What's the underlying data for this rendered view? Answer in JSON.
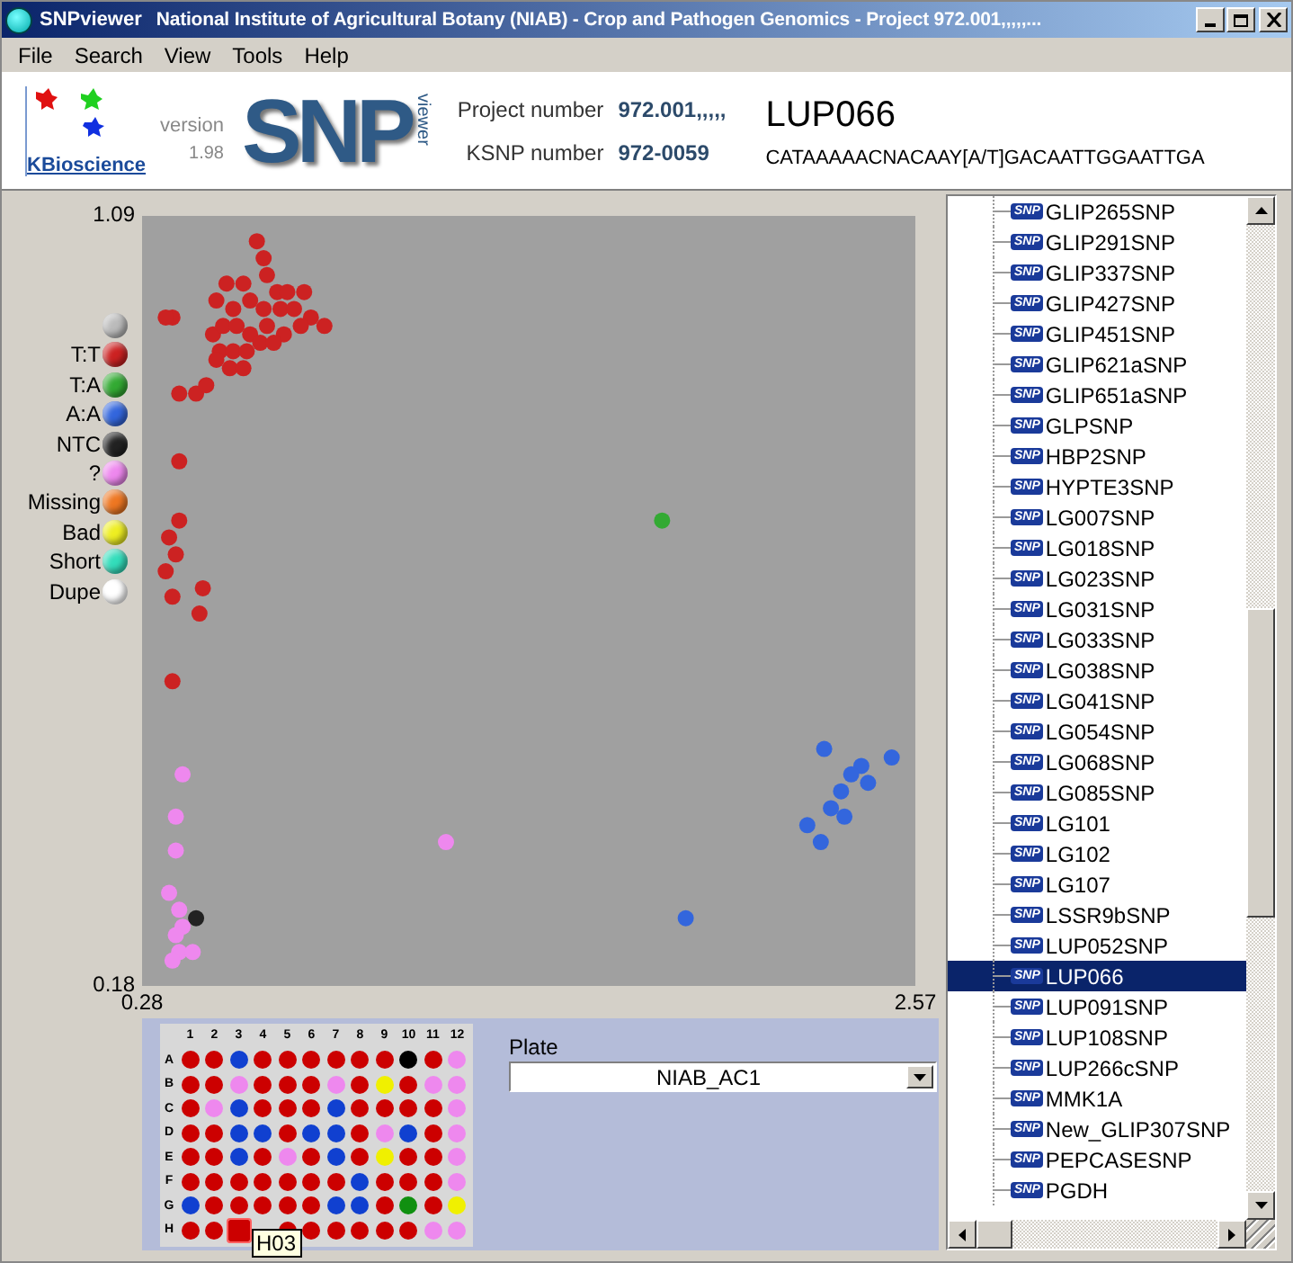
{
  "window": {
    "app_name": "SNPviewer",
    "title": "National Institute of Agricultural Botany (NIAB) - Crop and Pathogen Genomics - Project 972.001,,,,,..."
  },
  "menu": [
    "File",
    "Search",
    "View",
    "Tools",
    "Help"
  ],
  "header": {
    "company": "KBioscience",
    "version_label": "version",
    "version": "1.98",
    "logo_text": "SNP",
    "logo_subtext": "viewer",
    "project_label": "Project number",
    "project_value": "972.001,,,,,",
    "ksnp_label": "KSNP number",
    "ksnp_value": "972-0059",
    "snp_name": "LUP066",
    "sequence": "CATAAAAACNACAAY[A/T]GACAATTGGAATTGA"
  },
  "legend_top": [
    {
      "color": "#bbbbbb"
    }
  ],
  "legend_bottom": [
    {
      "label": "Missing",
      "color": "#ee7722"
    },
    {
      "label": "Bad",
      "color": "#eeee22"
    },
    {
      "label": "Short",
      "color": "#33ddbb"
    },
    {
      "label": "Dupe",
      "color": "#ffffff"
    }
  ],
  "plot": {
    "chart_data": {
      "type": "scatter",
      "xlim": [
        0.28,
        2.57
      ],
      "ylim": [
        0.18,
        1.09
      ],
      "xticks": [
        0.28,
        2.57
      ],
      "yticks": [
        0.18,
        1.09
      ],
      "series": [
        {
          "name": "T:T",
          "color": "#cc2222",
          "x": [
            0.62,
            0.64,
            0.65,
            0.58,
            0.53,
            0.68,
            0.71,
            0.76,
            0.5,
            0.55,
            0.6,
            0.64,
            0.69,
            0.73,
            0.78,
            0.82,
            0.37,
            0.35,
            0.49,
            0.52,
            0.56,
            0.6,
            0.65,
            0.7,
            0.75,
            0.51,
            0.55,
            0.59,
            0.63,
            0.67,
            0.54,
            0.58,
            0.5,
            0.39,
            0.44,
            0.47,
            0.39,
            0.39,
            0.36,
            0.38,
            0.35,
            0.37,
            0.46,
            0.45,
            0.37
          ],
          "values": [
            1.06,
            1.04,
            1.02,
            1.01,
            1.01,
            1.0,
            1.0,
            1.0,
            0.99,
            0.98,
            0.99,
            0.98,
            0.98,
            0.98,
            0.97,
            0.96,
            0.97,
            0.97,
            0.95,
            0.96,
            0.96,
            0.95,
            0.96,
            0.95,
            0.96,
            0.93,
            0.93,
            0.93,
            0.94,
            0.94,
            0.91,
            0.91,
            0.92,
            0.88,
            0.88,
            0.89,
            0.8,
            0.73,
            0.71,
            0.69,
            0.67,
            0.64,
            0.65,
            0.62,
            0.54
          ]
        },
        {
          "name": "T:A",
          "color": "#33aa33",
          "x": [
            1.82
          ],
          "values": [
            0.73
          ]
        },
        {
          "name": "A:A",
          "color": "#3366dd",
          "x": [
            2.3,
            2.5,
            2.41,
            2.38,
            2.43,
            2.35,
            2.32,
            2.36,
            2.25,
            2.29,
            1.89
          ],
          "values": [
            0.46,
            0.45,
            0.44,
            0.43,
            0.42,
            0.41,
            0.39,
            0.38,
            0.37,
            0.35,
            0.26
          ]
        },
        {
          "name": "NTC",
          "color": "#222222",
          "x": [
            0.44
          ],
          "values": [
            0.26
          ]
        },
        {
          "name": "?",
          "color": "#ee88ee",
          "x": [
            0.4,
            0.38,
            0.38,
            1.18,
            0.36,
            0.39,
            0.4,
            0.38,
            0.39,
            0.43,
            0.37
          ],
          "values": [
            0.43,
            0.38,
            0.34,
            0.35,
            0.29,
            0.27,
            0.25,
            0.24,
            0.22,
            0.22,
            0.21
          ]
        }
      ]
    }
  },
  "plate": {
    "columns": [
      "1",
      "2",
      "3",
      "4",
      "5",
      "6",
      "7",
      "8",
      "9",
      "10",
      "11",
      "12"
    ],
    "rows": [
      {
        "label": "A",
        "wells": [
          {
            "color": "#cc0000"
          },
          {
            "color": "#cc0000"
          },
          {
            "color": "#1040d0"
          },
          {
            "color": "#cc0000"
          },
          {
            "color": "#cc0000"
          },
          {
            "color": "#cc0000"
          },
          {
            "color": "#cc0000"
          },
          {
            "color": "#cc0000"
          },
          {
            "color": "#cc0000"
          },
          {
            "color": "#000000"
          },
          {
            "color": "#cc0000"
          },
          {
            "color": "#ee88ee"
          }
        ]
      },
      {
        "label": "B",
        "wells": [
          {
            "color": "#cc0000"
          },
          {
            "color": "#cc0000"
          },
          {
            "color": "#ee88ee"
          },
          {
            "color": "#cc0000"
          },
          {
            "color": "#cc0000"
          },
          {
            "color": "#cc0000"
          },
          {
            "color": "#ee88ee"
          },
          {
            "color": "#cc0000"
          },
          {
            "color": "#f0f000"
          },
          {
            "color": "#cc0000"
          },
          {
            "color": "#ee88ee"
          },
          {
            "color": "#ee88ee"
          }
        ]
      },
      {
        "label": "C",
        "wells": [
          {
            "color": "#cc0000"
          },
          {
            "color": "#ee88ee"
          },
          {
            "color": "#1040d0"
          },
          {
            "color": "#cc0000"
          },
          {
            "color": "#cc0000"
          },
          {
            "color": "#cc0000"
          },
          {
            "color": "#1040d0"
          },
          {
            "color": "#cc0000"
          },
          {
            "color": "#cc0000"
          },
          {
            "color": "#cc0000"
          },
          {
            "color": "#cc0000"
          },
          {
            "color": "#ee88ee"
          }
        ]
      },
      {
        "label": "D",
        "wells": [
          {
            "color": "#cc0000"
          },
          {
            "color": "#cc0000"
          },
          {
            "color": "#1040d0"
          },
          {
            "color": "#1040d0"
          },
          {
            "color": "#cc0000"
          },
          {
            "color": "#1040d0"
          },
          {
            "color": "#1040d0"
          },
          {
            "color": "#cc0000"
          },
          {
            "color": "#ee88ee"
          },
          {
            "color": "#1040d0"
          },
          {
            "color": "#cc0000"
          },
          {
            "color": "#ee88ee"
          }
        ]
      },
      {
        "label": "E",
        "wells": [
          {
            "color": "#cc0000"
          },
          {
            "color": "#cc0000"
          },
          {
            "color": "#1040d0"
          },
          {
            "color": "#cc0000"
          },
          {
            "color": "#ee88ee"
          },
          {
            "color": "#cc0000"
          },
          {
            "color": "#1040d0"
          },
          {
            "color": "#cc0000"
          },
          {
            "color": "#f0f000"
          },
          {
            "color": "#cc0000"
          },
          {
            "color": "#cc0000"
          },
          {
            "color": "#ee88ee"
          }
        ]
      },
      {
        "label": "F",
        "wells": [
          {
            "color": "#cc0000"
          },
          {
            "color": "#cc0000"
          },
          {
            "color": "#cc0000"
          },
          {
            "color": "#cc0000"
          },
          {
            "color": "#cc0000"
          },
          {
            "color": "#cc0000"
          },
          {
            "color": "#cc0000"
          },
          {
            "color": "#1040d0"
          },
          {
            "color": "#cc0000"
          },
          {
            "color": "#cc0000"
          },
          {
            "color": "#cc0000"
          },
          {
            "color": "#ee88ee"
          }
        ]
      },
      {
        "label": "G",
        "wells": [
          {
            "color": "#1040d0"
          },
          {
            "color": "#cc0000"
          },
          {
            "color": "#cc0000"
          },
          {
            "color": "#cc0000"
          },
          {
            "color": "#cc0000"
          },
          {
            "color": "#cc0000"
          },
          {
            "color": "#1040d0"
          },
          {
            "color": "#1040d0"
          },
          {
            "color": "#cc0000"
          },
          {
            "color": "#109010"
          },
          {
            "color": "#cc0000"
          },
          {
            "color": "#f0f000"
          }
        ]
      },
      {
        "label": "H",
        "wells": [
          {
            "color": "#cc0000",
            "selected": false
          },
          {
            "color": "#cc0000",
            "selected": false
          },
          {
            "color": "#cc0000",
            "selected": true
          },
          {
            "color": "#cc0000",
            "selected": false
          },
          {
            "color": "#cc0000",
            "selected": false
          },
          {
            "color": "#cc0000",
            "selected": false
          },
          {
            "color": "#cc0000",
            "selected": false
          },
          {
            "color": "#cc0000",
            "selected": false
          },
          {
            "color": "#cc0000",
            "selected": false
          },
          {
            "color": "#ee88ee",
            "selected": false
          },
          {
            "color": "#ee88ee",
            "selected": false
          }
        ]
      }
    ],
    "tooltip": "H03",
    "plate_label": "Plate",
    "plate_value": "NIAB_AC1"
  },
  "tree": {
    "items": [
      {
        "badge": "SNP",
        "label": "GLIP265SNP",
        "selected": false
      },
      {
        "badge": "SNP",
        "label": "GLIP291SNP",
        "selected": false
      },
      {
        "badge": "SNP",
        "label": "GLIP337SNP",
        "selected": false
      },
      {
        "badge": "SNP",
        "label": "GLIP427SNP",
        "selected": false
      },
      {
        "badge": "SNP",
        "label": "GLIP451SNP",
        "selected": false
      },
      {
        "badge": "SNP",
        "label": "GLIP621aSNP",
        "selected": false
      },
      {
        "badge": "SNP",
        "label": "GLIP651aSNP",
        "selected": false
      },
      {
        "badge": "SNP",
        "label": "GLPSNP",
        "selected": false
      },
      {
        "badge": "SNP",
        "label": "HBP2SNP",
        "selected": false
      },
      {
        "badge": "SNP",
        "label": "HYPTE3SNP",
        "selected": false
      },
      {
        "badge": "SNP",
        "label": "LG007SNP",
        "selected": false
      },
      {
        "badge": "SNP",
        "label": "LG018SNP",
        "selected": false
      },
      {
        "badge": "SNP",
        "label": "LG023SNP",
        "selected": false
      },
      {
        "badge": "SNP",
        "label": "LG031SNP",
        "selected": false
      },
      {
        "badge": "SNP",
        "label": "LG033SNP",
        "selected": false
      },
      {
        "badge": "SNP",
        "label": "LG038SNP",
        "selected": false
      },
      {
        "badge": "SNP",
        "label": "LG041SNP",
        "selected": false
      },
      {
        "badge": "SNP",
        "label": "LG054SNP",
        "selected": false
      },
      {
        "badge": "SNP",
        "label": "LG068SNP",
        "selected": false
      },
      {
        "badge": "SNP",
        "label": "LG085SNP",
        "selected": false
      },
      {
        "badge": "SNP",
        "label": "LG101",
        "selected": false
      },
      {
        "badge": "SNP",
        "label": "LG102",
        "selected": false
      },
      {
        "badge": "SNP",
        "label": "LG107",
        "selected": false
      },
      {
        "badge": "SNP",
        "label": "LSSR9bSNP",
        "selected": false
      },
      {
        "badge": "SNP",
        "label": "LUP052SNP",
        "selected": false
      },
      {
        "badge": "SNP",
        "label": "LUP066",
        "selected": true
      },
      {
        "badge": "SNP",
        "label": "LUP091SNP",
        "selected": false
      },
      {
        "badge": "SNP",
        "label": "LUP108SNP",
        "selected": false
      },
      {
        "badge": "SNP",
        "label": "LUP266cSNP",
        "selected": false
      },
      {
        "badge": "SNP",
        "label": "MMK1A",
        "selected": false
      },
      {
        "badge": "SNP",
        "label": "New_GLIP307SNP",
        "selected": false
      },
      {
        "badge": "SNP",
        "label": "PEPCASESNP",
        "selected": false
      },
      {
        "badge": "SNP",
        "label": "PGDH",
        "selected": false
      }
    ]
  }
}
